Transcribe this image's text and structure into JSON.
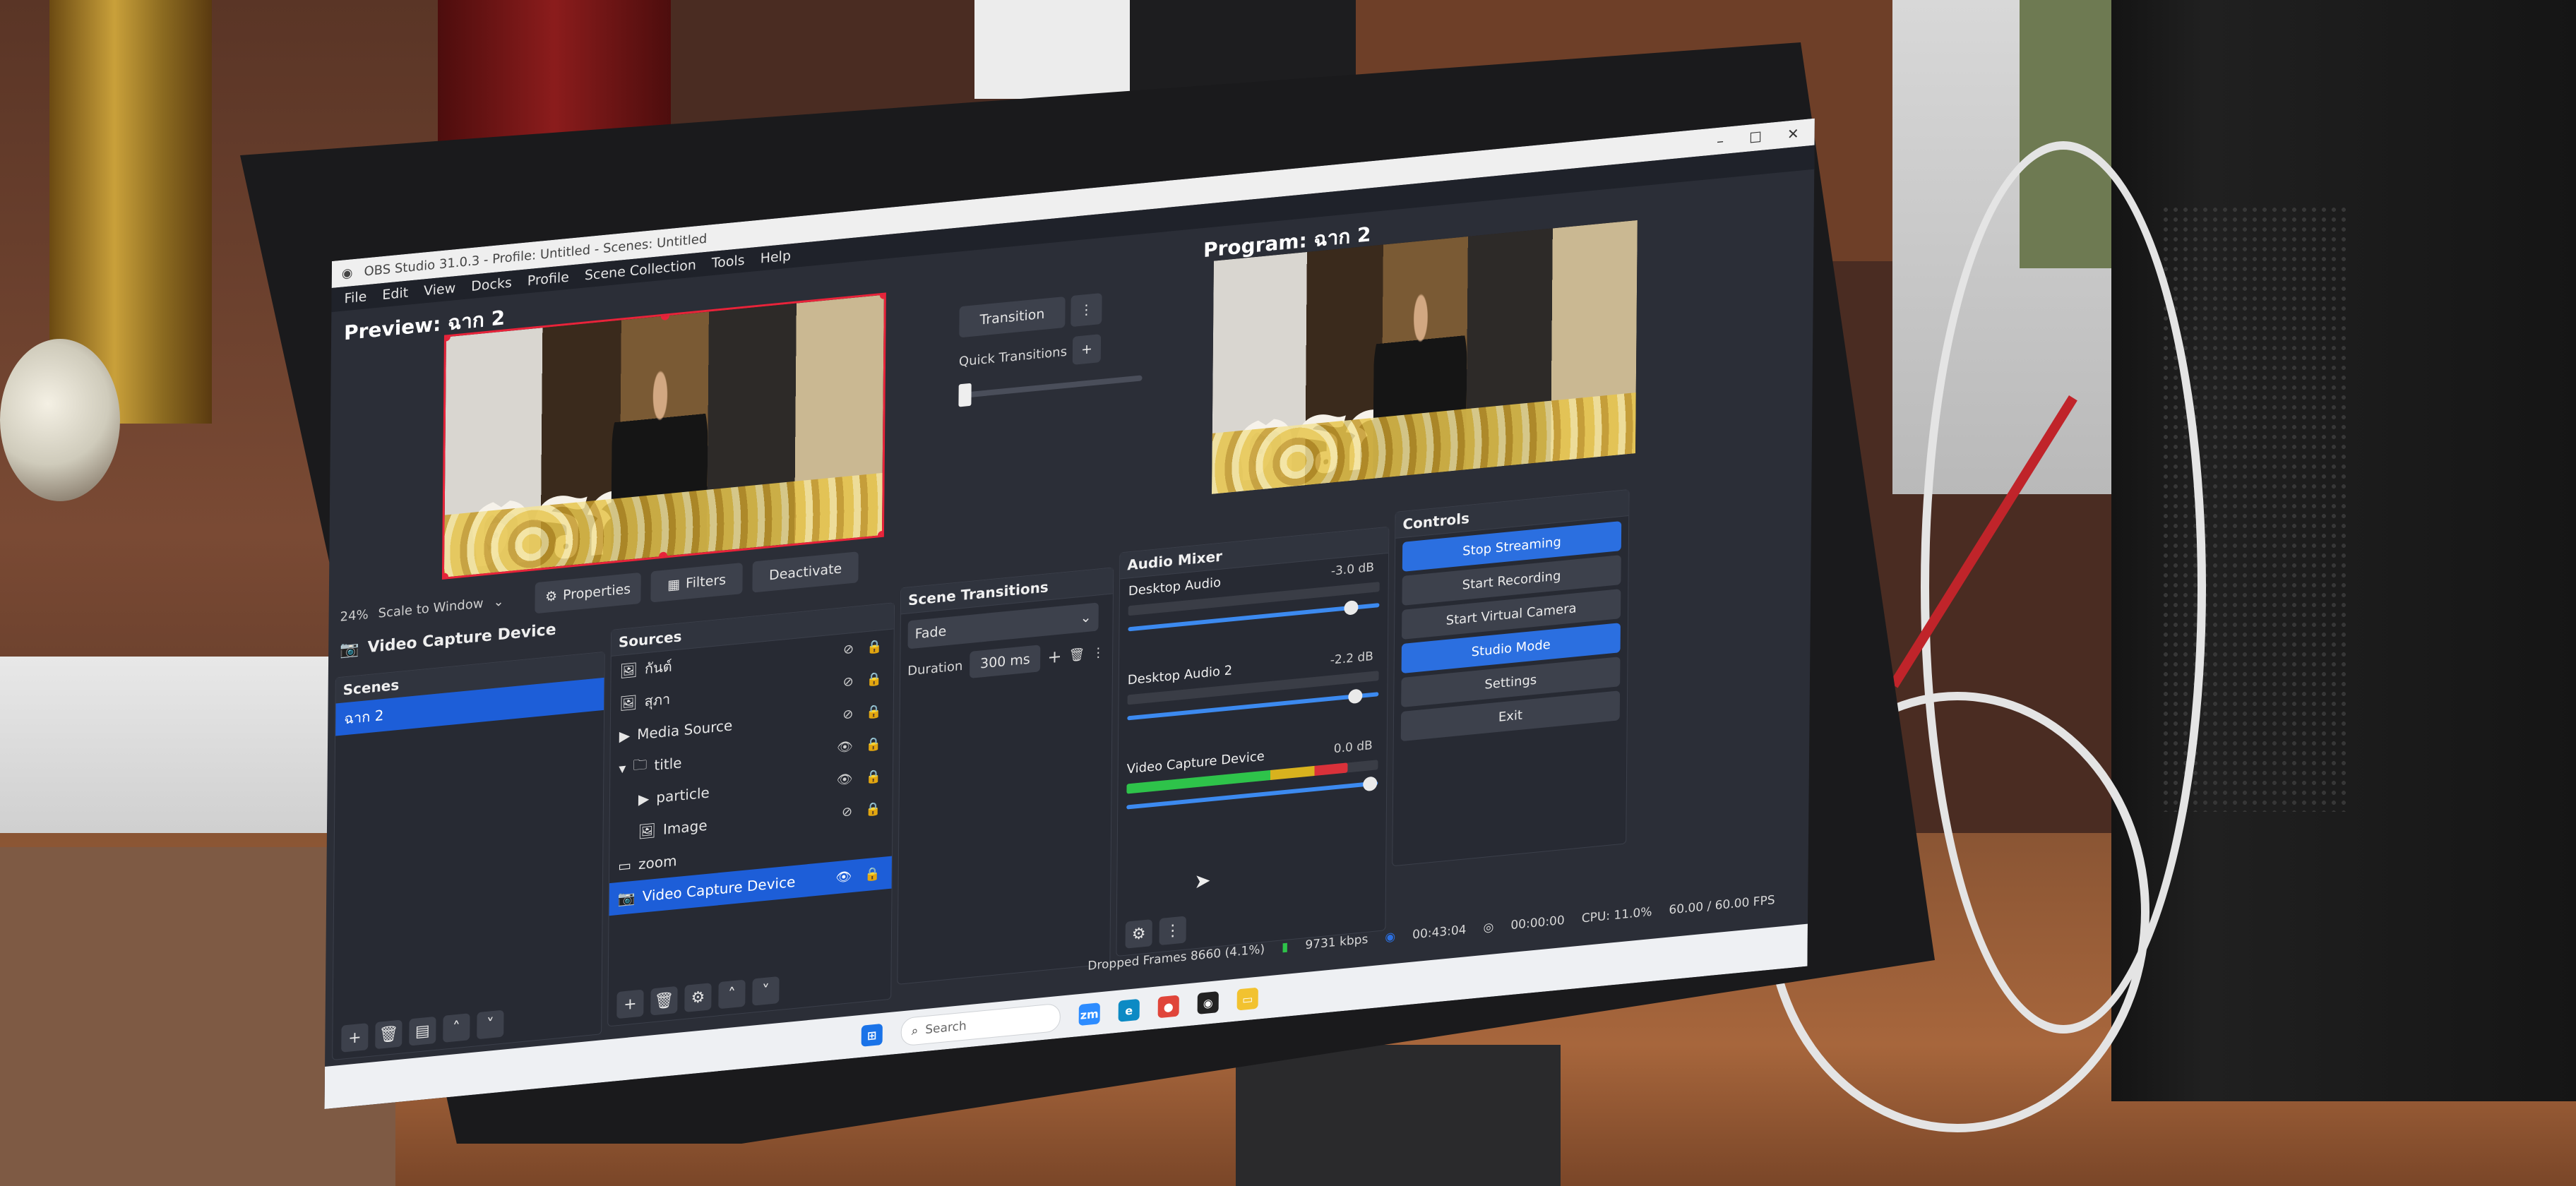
{
  "app": {
    "title": "OBS Studio 31.0.3 - Profile: Untitled - Scenes: Untitled",
    "window_controls": [
      "–",
      "☐",
      "✕"
    ]
  },
  "menu": [
    "File",
    "Edit",
    "View",
    "Docks",
    "Profile",
    "Scene Collection",
    "Tools",
    "Help"
  ],
  "preview": {
    "label": "Preview: ฉาก 2",
    "zoom": "24%",
    "scale_mode": "Scale to Window",
    "selection_color": "#e8233a"
  },
  "program": {
    "label": "Program: ฉาก 2"
  },
  "transition": {
    "button": "Transition",
    "quick_label": "Quick Transitions"
  },
  "source_toolbar": {
    "title": "Video Capture Device",
    "properties": "Properties",
    "filters": "Filters",
    "deactivate": "Deactivate"
  },
  "scenes": {
    "header": "Scenes",
    "items": [
      {
        "label": "ฉาก 2",
        "selected": true
      }
    ]
  },
  "sources": {
    "header": "Sources",
    "items": [
      {
        "label": "กันต์"
      },
      {
        "label": "สุภา"
      },
      {
        "label": "Media Source"
      },
      {
        "label": "title"
      },
      {
        "label": "particle"
      },
      {
        "label": "Image"
      },
      {
        "label": "zoom"
      },
      {
        "label": "Video Capture Device",
        "selected": true
      }
    ]
  },
  "scene_transitions": {
    "header": "Scene Transitions",
    "type": "Fade",
    "duration_label": "Duration",
    "duration_value": "300 ms"
  },
  "audio_mixer": {
    "header": "Audio Mixer",
    "channels": [
      {
        "name": "Desktop Audio",
        "db": "-3.0 dB",
        "level": 0.0
      },
      {
        "name": "Desktop Audio 2",
        "db": "-2.2 dB",
        "level": 0.0
      },
      {
        "name": "Video Capture Device",
        "db": "0.0 dB",
        "level": 0.88
      }
    ]
  },
  "controls": {
    "header": "Controls",
    "stop_streaming": "Stop Streaming",
    "start_recording": "Start Recording",
    "start_virtual_camera": "Start Virtual Camera",
    "studio_mode": "Studio Mode",
    "settings": "Settings",
    "exit": "Exit"
  },
  "status": {
    "dropped_frames": "Dropped Frames 8660 (4.1%)",
    "bitrate": "9731 kbps",
    "stream_time": "00:43:04",
    "record_time": "00:00:00",
    "cpu": "CPU: 11.0%",
    "fps": "60.00 / 60.00 FPS"
  },
  "taskbar": {
    "search_placeholder": "Search",
    "icons": [
      "windows-start-icon",
      "zoom-icon",
      "edge-icon",
      "chrome-icon",
      "obs-icon",
      "file-explorer-icon"
    ]
  },
  "colors": {
    "accent": "#1d5ed8",
    "button_blue": "#2b6fe0",
    "meter_green": "#2ec34a",
    "meter_yellow": "#d8b21e",
    "meter_red": "#d9313a"
  }
}
